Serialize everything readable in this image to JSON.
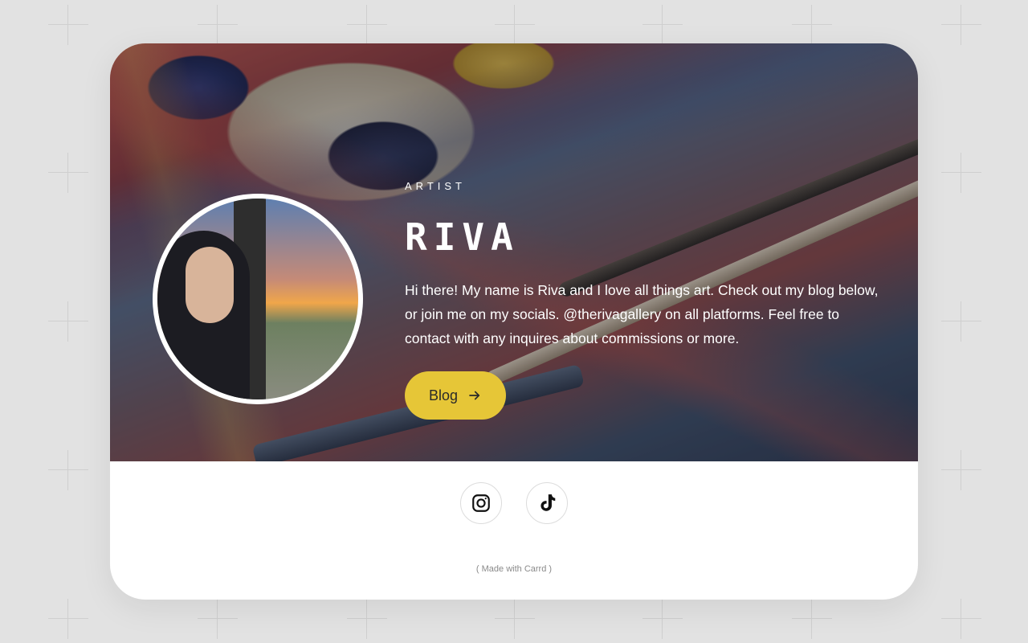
{
  "profile": {
    "role": "ARTIST",
    "name": "RIVA",
    "bio": "Hi there! My name is Riva and I love all things art. Check out my blog below, or join me on my socials. @therivagallery on all platforms. Feel free to contact with any inquires about commissions or more."
  },
  "actions": {
    "blog_label": "Blog"
  },
  "socials": [
    {
      "name": "instagram-icon"
    },
    {
      "name": "tiktok-icon"
    }
  ],
  "footer": {
    "credit": "( Made with Carrd )"
  },
  "colors": {
    "page_bg": "#e2e2e2",
    "card_bg": "#ffffff",
    "button_bg": "#e6c637"
  }
}
